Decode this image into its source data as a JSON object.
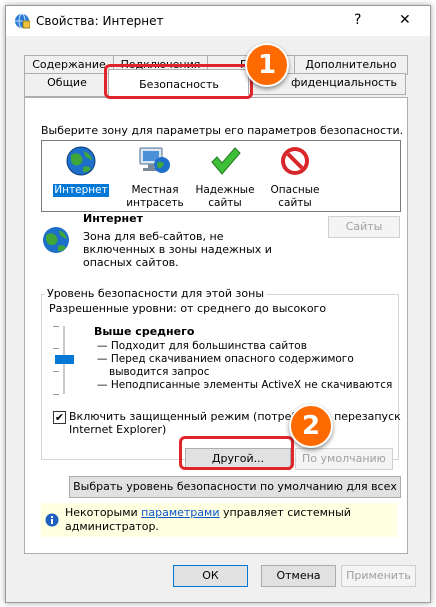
{
  "window": {
    "title": "Свойства: Интернет",
    "help_label": "?",
    "close_label": "✕"
  },
  "tabs_back": [
    "Содержание",
    "Подключения",
    "Про",
    "Дополнительно"
  ],
  "tabs_front": [
    "Общие",
    "Безопасность",
    "фиденциальность"
  ],
  "zones": {
    "prompt": "Выберите зону для параметры его параметров безопасности.",
    "items": [
      {
        "icon": "globe-icon",
        "label": "Интернет"
      },
      {
        "icon": "intranet-icon",
        "label": "Местная интрасеть"
      },
      {
        "icon": "checkmark-icon",
        "label": "Надежные сайты"
      },
      {
        "icon": "restricted-icon",
        "label": "Опасные сайты"
      }
    ]
  },
  "zone_info": {
    "title": "Интернет",
    "description": "Зона для веб-сайтов, не включенных в зоны надежных и опасных сайтов.",
    "sites_button": "Сайты"
  },
  "security_level": {
    "group_title": "Уровень безопасности для этой зоны",
    "allowed": "Разрешенные уровни: от среднего до высокого",
    "level_name": "Выше среднего",
    "bullets": [
      "— Подходит для большинства сайтов",
      "— Перед скачиванием опасного содержимого",
      "выводится запрос",
      "— Неподписанные элементы ActiveX не скачиваются"
    ],
    "protected_mode_line1": "Включить защищенный режим (потребуется перезапуск",
    "protected_mode_line2": "Internet Explorer)",
    "protected_mode_checked": true,
    "custom_button": "Другой...",
    "default_button": "По умолчанию"
  },
  "reset_all_button": "Выбрать уровень безопасности по умолчанию для всех зон",
  "info_bar": {
    "before_link": "Некоторыми ",
    "link": "параметрами",
    "after_link": " управляет системный",
    "line2": "администратор."
  },
  "footer": {
    "ok": "ОК",
    "cancel": "Отмена",
    "apply": "Применить"
  },
  "callouts": [
    "1",
    "2"
  ],
  "colors": {
    "callout": "#ff6a00",
    "highlight": "#e0252a",
    "selection": "#0078d7"
  }
}
